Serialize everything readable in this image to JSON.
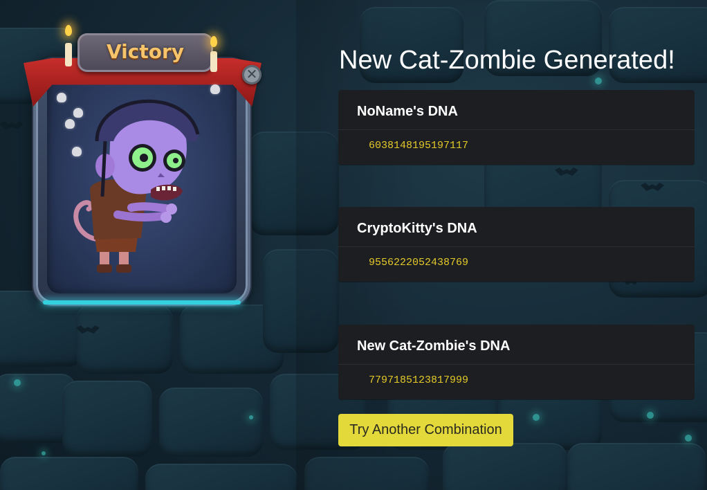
{
  "card": {
    "banner": "Victory",
    "close_icon": "close-icon"
  },
  "title": "New Cat-Zombie Generated!",
  "panels": [
    {
      "heading": "NoName's DNA",
      "dna": "6038148195197117"
    },
    {
      "heading": "CryptoKitty's DNA",
      "dna": "9556222052438769"
    },
    {
      "heading": "New Cat-Zombie's DNA",
      "dna": "7797185123817999"
    }
  ],
  "button": {
    "label": "Try Another Combination"
  },
  "colors": {
    "dna_text": "#e3c929",
    "button_bg": "#e3d93a",
    "panel_bg": "#1d1e22",
    "banner_text": "#f6c46a"
  }
}
